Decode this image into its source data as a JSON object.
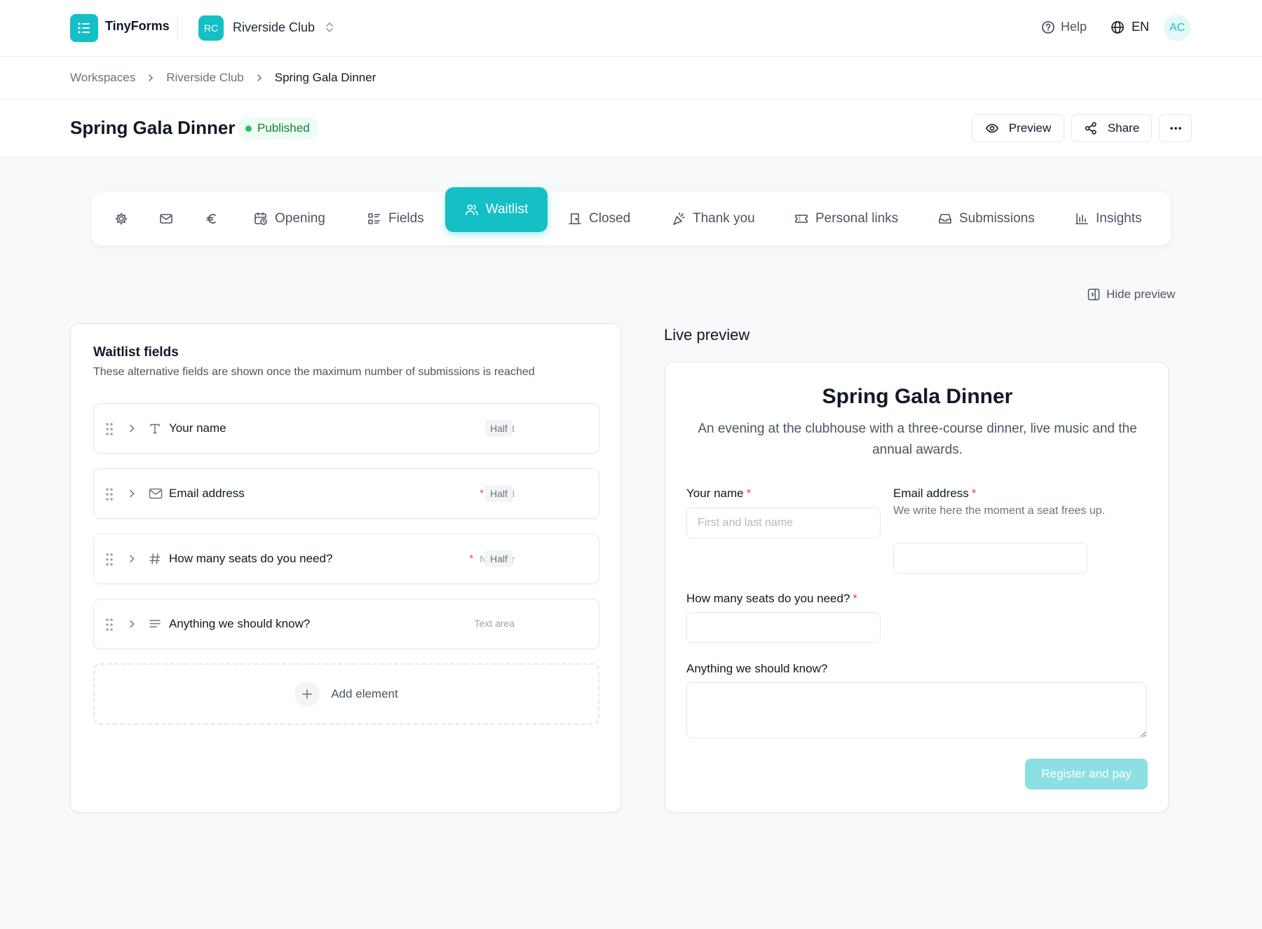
{
  "app": {
    "brand": "TinyForms",
    "workspace_initials": "RC",
    "workspace_name": "Riverside Club",
    "help_label": "Help",
    "language": "EN",
    "user_initials": "AC"
  },
  "breadcrumb": [
    "Workspaces",
    "Riverside Club",
    "Spring Gala Dinner"
  ],
  "header": {
    "title": "Spring Gala Dinner",
    "status": "Published",
    "preview_label": "Preview",
    "share_label": "Share"
  },
  "tabs": [
    {
      "icon": "gear-icon",
      "label": ""
    },
    {
      "icon": "mail-icon",
      "label": ""
    },
    {
      "icon": "euro-icon",
      "label": ""
    },
    {
      "icon": "calendar-clock-icon",
      "label": "Opening"
    },
    {
      "icon": "list-icon",
      "label": "Fields"
    },
    {
      "icon": "users-icon",
      "label": "Waitlist",
      "active": true
    },
    {
      "icon": "door-icon",
      "label": "Closed"
    },
    {
      "icon": "party-icon",
      "label": "Thank you"
    },
    {
      "icon": "ticket-icon",
      "label": "Personal links"
    },
    {
      "icon": "inbox-icon",
      "label": "Submissions"
    },
    {
      "icon": "bar-chart-icon",
      "label": "Insights"
    }
  ],
  "hide_preview_label": "Hide preview",
  "waitlist": {
    "title": "Waitlist fields",
    "description": "These alternative fields are shown once the maximum number of submissions is reached",
    "fields": [
      {
        "icon": "text-icon",
        "label": "Your name",
        "required": "*",
        "type": "Text",
        "width": "Half"
      },
      {
        "icon": "mail-icon",
        "label": "Email address",
        "required": "*",
        "type": "Email",
        "width": "Half"
      },
      {
        "icon": "hash-icon",
        "label": "How many seats do you need?",
        "required": "*",
        "type": "Number",
        "width": "Half"
      },
      {
        "icon": "textarea-icon",
        "label": "Anything we should know?",
        "required": "",
        "type": "Text area",
        "width": ""
      }
    ],
    "add_label": "Add element"
  },
  "preview": {
    "heading": "Live preview",
    "title": "Spring Gala Dinner",
    "description": "An evening at the clubhouse with a three-course dinner, live music and the annual awards.",
    "name_label": "Your name",
    "name_placeholder": "First and last name",
    "email_label": "Email address",
    "email_help": "We write here the moment a seat frees up.",
    "seats_label": "How many seats do you need?",
    "notes_label": "Anything we should know?",
    "required_mark": "*",
    "submit_label": "Register and pay"
  },
  "colors": {
    "accent": "#14bfc6",
    "status_green": "#22c55e",
    "required_red": "#ef4444"
  }
}
